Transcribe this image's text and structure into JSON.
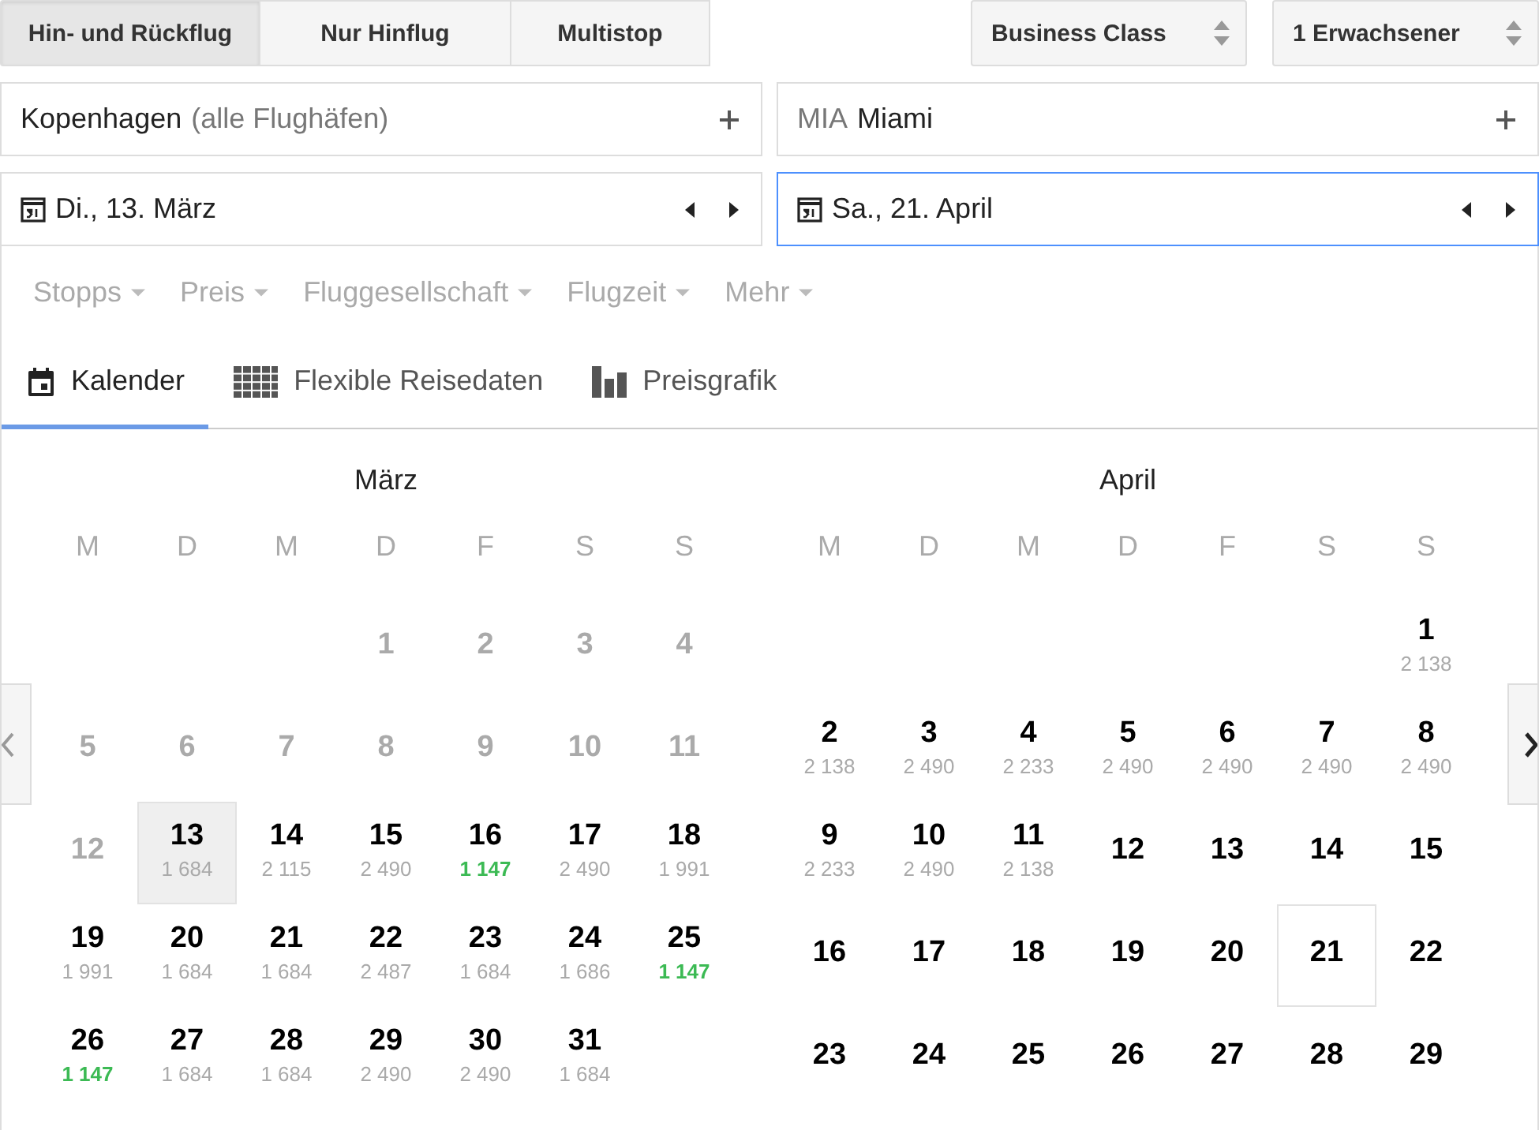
{
  "trip_types": [
    {
      "label": "Hin- und Rückflug",
      "selected": true
    },
    {
      "label": "Nur Hinflug",
      "selected": false
    },
    {
      "label": "Multistop",
      "selected": false
    }
  ],
  "selectors": [
    {
      "label": "Business Class"
    },
    {
      "label": "1 Erwachsener"
    }
  ],
  "places": [
    {
      "parts": [
        {
          "text": "Kopenhagen",
          "muted": false
        },
        {
          "text": "(alle Flughäfen)",
          "muted": true
        }
      ]
    },
    {
      "parts": [
        {
          "text": "MIA",
          "muted": true
        },
        {
          "text": "Miami",
          "muted": false
        }
      ]
    }
  ],
  "dates": [
    {
      "label": "Di., 13. März",
      "focused": false
    },
    {
      "label": "Sa., 21. April",
      "focused": true
    }
  ],
  "filters": [
    {
      "label": "Stopps"
    },
    {
      "label": "Preis"
    },
    {
      "label": "Fluggesellschaft"
    },
    {
      "label": "Flugzeit"
    },
    {
      "label": "Mehr"
    }
  ],
  "views": [
    {
      "label": "Kalender",
      "kind": "calendar",
      "selected": true
    },
    {
      "label": "Flexible Reisedaten",
      "kind": "grid",
      "selected": false
    },
    {
      "label": "Preisgrafik",
      "kind": "bars",
      "selected": false
    }
  ],
  "months": [
    {
      "title": "März",
      "selection_outlined": false,
      "weekdays": [
        "M",
        "D",
        "M",
        "D",
        "F",
        "S",
        "S"
      ],
      "days": [
        {
          "kind": "blank"
        },
        {
          "kind": "blank"
        },
        {
          "kind": "blank"
        },
        {
          "kind": "day",
          "day": "1",
          "disabled": true,
          "selected": false
        },
        {
          "kind": "day",
          "day": "2",
          "disabled": true,
          "selected": false
        },
        {
          "kind": "day",
          "day": "3",
          "disabled": true,
          "selected": false
        },
        {
          "kind": "day",
          "day": "4",
          "disabled": true,
          "selected": false
        },
        {
          "kind": "day",
          "day": "5",
          "disabled": true,
          "selected": false
        },
        {
          "kind": "day",
          "day": "6",
          "disabled": true,
          "selected": false
        },
        {
          "kind": "day",
          "day": "7",
          "disabled": true,
          "selected": false
        },
        {
          "kind": "day",
          "day": "8",
          "disabled": true,
          "selected": false
        },
        {
          "kind": "day",
          "day": "9",
          "disabled": true,
          "selected": false
        },
        {
          "kind": "day",
          "day": "10",
          "disabled": true,
          "selected": false
        },
        {
          "kind": "day",
          "day": "11",
          "disabled": true,
          "selected": false
        },
        {
          "kind": "day",
          "day": "12",
          "disabled": true,
          "selected": false
        },
        {
          "kind": "day",
          "day": "13",
          "price": "1 684",
          "cheapest": false,
          "disabled": false,
          "selected": true
        },
        {
          "kind": "day",
          "day": "14",
          "price": "2 115",
          "cheapest": false,
          "disabled": false,
          "selected": false
        },
        {
          "kind": "day",
          "day": "15",
          "price": "2 490",
          "cheapest": false,
          "disabled": false,
          "selected": false
        },
        {
          "kind": "day",
          "day": "16",
          "price": "1 147",
          "cheapest": true,
          "disabled": false,
          "selected": false
        },
        {
          "kind": "day",
          "day": "17",
          "price": "2 490",
          "cheapest": false,
          "disabled": false,
          "selected": false
        },
        {
          "kind": "day",
          "day": "18",
          "price": "1 991",
          "cheapest": false,
          "disabled": false,
          "selected": false
        },
        {
          "kind": "day",
          "day": "19",
          "price": "1 991",
          "cheapest": false,
          "disabled": false,
          "selected": false
        },
        {
          "kind": "day",
          "day": "20",
          "price": "1 684",
          "cheapest": false,
          "disabled": false,
          "selected": false
        },
        {
          "kind": "day",
          "day": "21",
          "price": "1 684",
          "cheapest": false,
          "disabled": false,
          "selected": false
        },
        {
          "kind": "day",
          "day": "22",
          "price": "2 487",
          "cheapest": false,
          "disabled": false,
          "selected": false
        },
        {
          "kind": "day",
          "day": "23",
          "price": "1 684",
          "cheapest": false,
          "disabled": false,
          "selected": false
        },
        {
          "kind": "day",
          "day": "24",
          "price": "1 686",
          "cheapest": false,
          "disabled": false,
          "selected": false
        },
        {
          "kind": "day",
          "day": "25",
          "price": "1 147",
          "cheapest": true,
          "disabled": false,
          "selected": false
        },
        {
          "kind": "day",
          "day": "26",
          "price": "1 147",
          "cheapest": true,
          "disabled": false,
          "selected": false
        },
        {
          "kind": "day",
          "day": "27",
          "price": "1 684",
          "cheapest": false,
          "disabled": false,
          "selected": false
        },
        {
          "kind": "day",
          "day": "28",
          "price": "1 684",
          "cheapest": false,
          "disabled": false,
          "selected": false
        },
        {
          "kind": "day",
          "day": "29",
          "price": "2 490",
          "cheapest": false,
          "disabled": false,
          "selected": false
        },
        {
          "kind": "day",
          "day": "30",
          "price": "2 490",
          "cheapest": false,
          "disabled": false,
          "selected": false
        },
        {
          "kind": "day",
          "day": "31",
          "price": "1 684",
          "cheapest": false,
          "disabled": false,
          "selected": false
        }
      ]
    },
    {
      "title": "April",
      "selection_outlined": true,
      "weekdays": [
        "M",
        "D",
        "M",
        "D",
        "F",
        "S",
        "S"
      ],
      "days": [
        {
          "kind": "blank"
        },
        {
          "kind": "blank"
        },
        {
          "kind": "blank"
        },
        {
          "kind": "blank"
        },
        {
          "kind": "blank"
        },
        {
          "kind": "blank"
        },
        {
          "kind": "day",
          "day": "1",
          "price": "2 138",
          "cheapest": false,
          "disabled": false,
          "selected": false
        },
        {
          "kind": "day",
          "day": "2",
          "price": "2 138",
          "cheapest": false,
          "disabled": false,
          "selected": false
        },
        {
          "kind": "day",
          "day": "3",
          "price": "2 490",
          "cheapest": false,
          "disabled": false,
          "selected": false
        },
        {
          "kind": "day",
          "day": "4",
          "price": "2 233",
          "cheapest": false,
          "disabled": false,
          "selected": false
        },
        {
          "kind": "day",
          "day": "5",
          "price": "2 490",
          "cheapest": false,
          "disabled": false,
          "selected": false
        },
        {
          "kind": "day",
          "day": "6",
          "price": "2 490",
          "cheapest": false,
          "disabled": false,
          "selected": false
        },
        {
          "kind": "day",
          "day": "7",
          "price": "2 490",
          "cheapest": false,
          "disabled": false,
          "selected": false
        },
        {
          "kind": "day",
          "day": "8",
          "price": "2 490",
          "cheapest": false,
          "disabled": false,
          "selected": false
        },
        {
          "kind": "day",
          "day": "9",
          "price": "2 233",
          "cheapest": false,
          "disabled": false,
          "selected": false
        },
        {
          "kind": "day",
          "day": "10",
          "price": "2 490",
          "cheapest": false,
          "disabled": false,
          "selected": false
        },
        {
          "kind": "day",
          "day": "11",
          "price": "2 138",
          "cheapest": false,
          "disabled": false,
          "selected": false
        },
        {
          "kind": "day",
          "day": "12",
          "disabled": false,
          "selected": false
        },
        {
          "kind": "day",
          "day": "13",
          "disabled": false,
          "selected": false
        },
        {
          "kind": "day",
          "day": "14",
          "disabled": false,
          "selected": false
        },
        {
          "kind": "day",
          "day": "15",
          "disabled": false,
          "selected": false
        },
        {
          "kind": "day",
          "day": "16",
          "disabled": false,
          "selected": false
        },
        {
          "kind": "day",
          "day": "17",
          "disabled": false,
          "selected": false
        },
        {
          "kind": "day",
          "day": "18",
          "disabled": false,
          "selected": false
        },
        {
          "kind": "day",
          "day": "19",
          "disabled": false,
          "selected": false
        },
        {
          "kind": "day",
          "day": "20",
          "disabled": false,
          "selected": false
        },
        {
          "kind": "day",
          "day": "21",
          "disabled": false,
          "selected": true
        },
        {
          "kind": "day",
          "day": "22",
          "disabled": false,
          "selected": false
        },
        {
          "kind": "day",
          "day": "23",
          "disabled": false,
          "selected": false
        },
        {
          "kind": "day",
          "day": "24",
          "disabled": false,
          "selected": false
        },
        {
          "kind": "day",
          "day": "25",
          "disabled": false,
          "selected": false
        },
        {
          "kind": "day",
          "day": "26",
          "disabled": false,
          "selected": false
        },
        {
          "kind": "day",
          "day": "27",
          "disabled": false,
          "selected": false
        },
        {
          "kind": "day",
          "day": "28",
          "disabled": false,
          "selected": false
        },
        {
          "kind": "day",
          "day": "29",
          "disabled": false,
          "selected": false
        }
      ]
    }
  ]
}
